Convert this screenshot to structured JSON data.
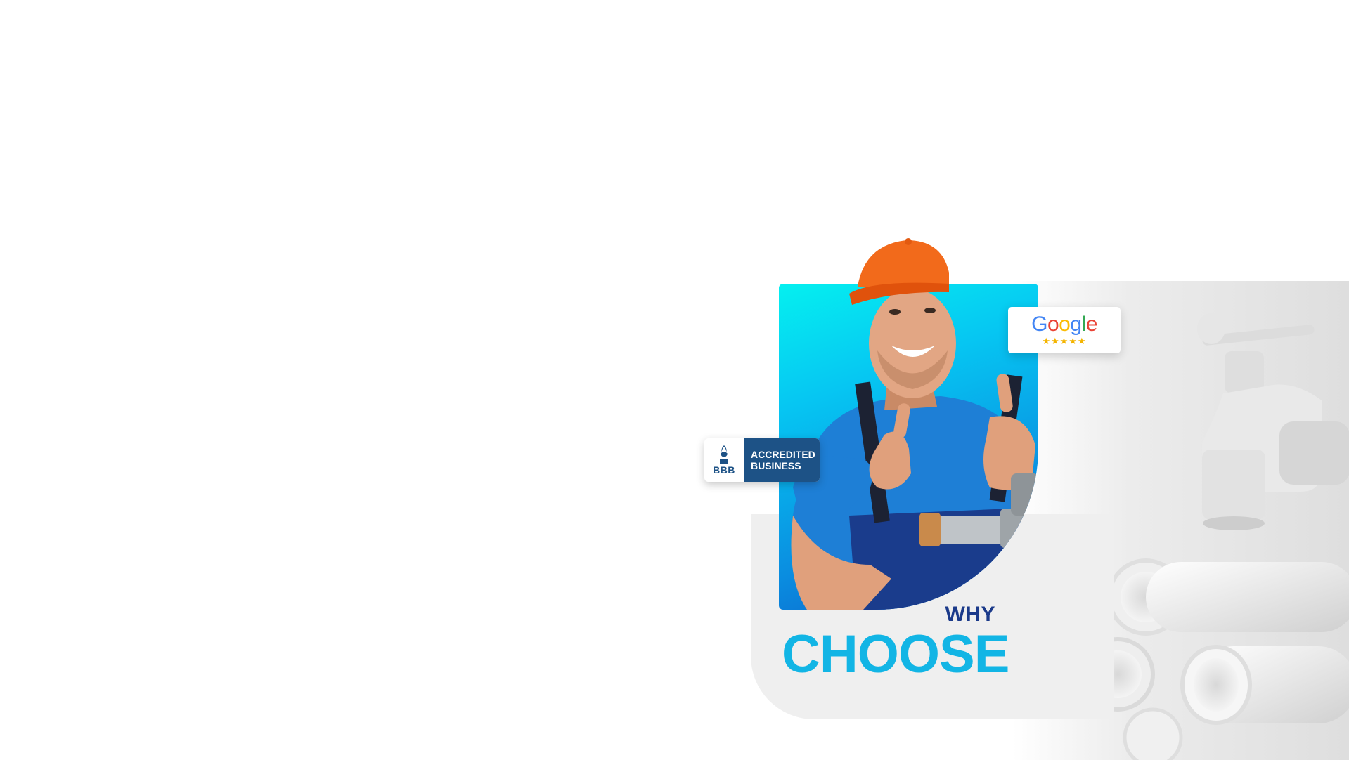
{
  "hero": {
    "heading_small": "WHY",
    "heading_large": "CHOOSE"
  },
  "badges": {
    "bbb": {
      "logo_text": "BBB",
      "line1": "ACCREDITED",
      "line2": "BUSINESS",
      "icon": "bbb-torch-icon"
    },
    "google": {
      "letters": [
        "G",
        "o",
        "o",
        "g",
        "l",
        "e"
      ],
      "stars": "★★★★★",
      "star_count": 5
    }
  },
  "colors": {
    "background": "#ffffff",
    "panel": "#efefef",
    "card_gradient_top": "#05f0f0",
    "card_gradient_bottom": "#0d5bc7",
    "why_text": "#1b3a8a",
    "choose_text": "#12b5e5",
    "bbb_blue": "#1d5286",
    "star_gold": "#f4b400",
    "hat_orange": "#f26a1b"
  },
  "images": {
    "photo": "plumber-thumbs-up-photo",
    "background": "white-pvc-pipes-and-faucet"
  }
}
